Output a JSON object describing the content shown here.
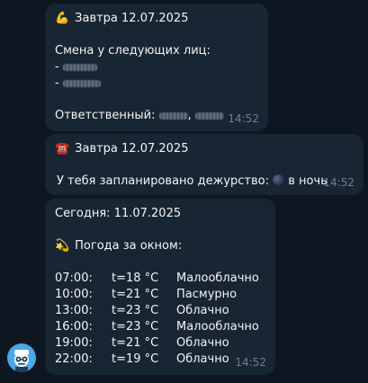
{
  "messages": [
    {
      "title_emoji": "💪",
      "title": "Завтра 12.07.2025",
      "shift_label": "Смена у следующих лиц:",
      "list_prefix": "-",
      "responsible_label": "Ответственный:",
      "responsible_separator": ",",
      "time": "14:52"
    },
    {
      "title_emoji": "☎️",
      "title": "Завтра 12.07.2025",
      "text_before": "У тебя запланировано дежурство:",
      "moon_icon": "new-moon-icon",
      "text_after": "в ночь",
      "time": "14:52"
    },
    {
      "title": "Сегодня: 11.07.2025",
      "weather_emoji": "💫",
      "weather_header": "Погода за окном:",
      "forecast": [
        {
          "time": "07:00:",
          "temp": "t=18 °C",
          "condition": "Малооблачно"
        },
        {
          "time": "10:00:",
          "temp": "t=21 °C",
          "condition": "Пасмурно"
        },
        {
          "time": "13:00:",
          "temp": "t=23 °C",
          "condition": "Облачно"
        },
        {
          "time": "16:00:",
          "temp": "t=23 °C",
          "condition": "Малооблачно"
        },
        {
          "time": "19:00:",
          "temp": "t=21 °C",
          "condition": "Облачно"
        },
        {
          "time": "22:00:",
          "temp": "t=19 °C",
          "condition": "Облачно"
        }
      ],
      "time": "14:52"
    }
  ],
  "avatar_icon": "bot-face-icon",
  "colors": {
    "background": "#0e1621",
    "bubble": "#182533",
    "text": "#f5f5f5",
    "timestamp": "#6d7f8f",
    "avatar": "#4da6e8"
  }
}
